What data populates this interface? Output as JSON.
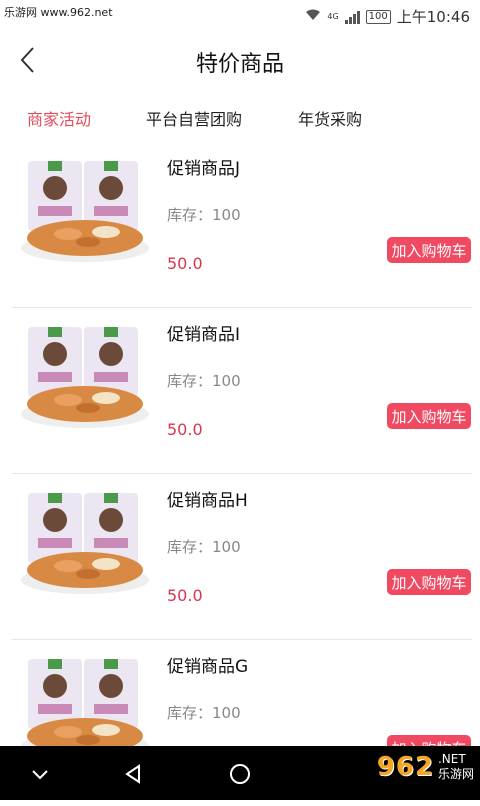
{
  "status_bar": {
    "watermark": "乐游网 www.962.net",
    "network": "4G",
    "battery": "100",
    "time": "上午10:46"
  },
  "header": {
    "title": "特价商品"
  },
  "tabs": [
    {
      "label": "商家活动",
      "active": true
    },
    {
      "label": "平台自营团购",
      "active": false
    },
    {
      "label": "年货采购",
      "active": false
    }
  ],
  "products": [
    {
      "name": "促销商品J",
      "stock": "库存：100",
      "price": "50.0",
      "button": "加入购物车"
    },
    {
      "name": "促销商品I",
      "stock": "库存：100",
      "price": "50.0",
      "button": "加入购物车"
    },
    {
      "name": "促销商品H",
      "stock": "库存：100",
      "price": "50.0",
      "button": "加入购物车"
    },
    {
      "name": "促销商品G",
      "stock": "库存：100",
      "price": "",
      "button": "加入购物车"
    }
  ],
  "watermark_logo": {
    "number": "962",
    "net": ".NET",
    "site": "乐游网"
  },
  "colors": {
    "accent": "#e64b5b",
    "button": "#ef4a62",
    "price": "#d9364f"
  }
}
